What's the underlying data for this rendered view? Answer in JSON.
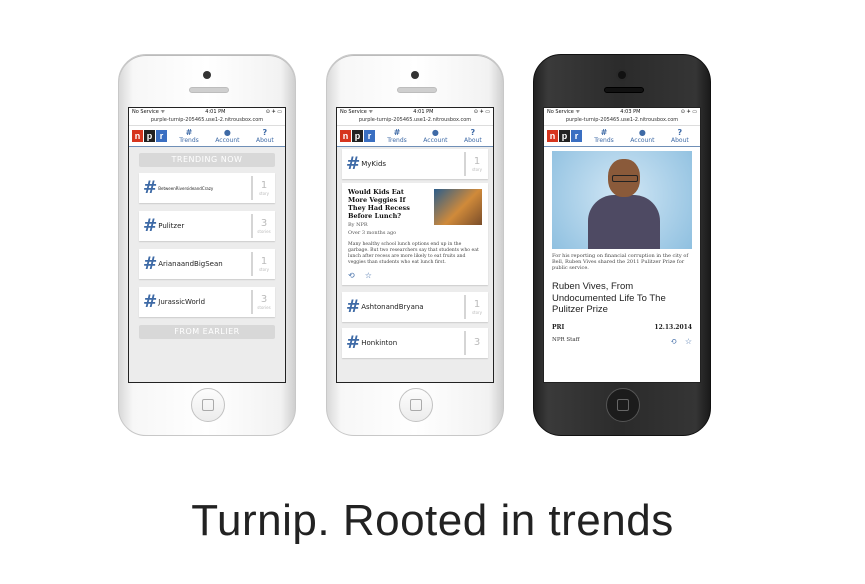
{
  "phones": [
    {
      "status_left": "No Service ᯤ",
      "time": "4:01 PM",
      "status_right": "⊙ ✈ ▭",
      "url": "purple-turnip-205465.use1-2.nitrousbox.com",
      "nav": [
        "Trends",
        "Account",
        "About"
      ],
      "banner_top": "TRENDING NOW",
      "tags": [
        {
          "name": "BetweenRiversideandCrazy",
          "count": "1",
          "unit": "story"
        },
        {
          "name": "Pulitzer",
          "count": "3",
          "unit": "stories"
        },
        {
          "name": "ArianaandBigSean",
          "count": "1",
          "unit": "story"
        },
        {
          "name": "JurassicWorld",
          "count": "3",
          "unit": "stories"
        }
      ],
      "banner_bottom": "FROM EARLIER"
    },
    {
      "status_left": "No Service ᯤ",
      "time": "4:01 PM",
      "status_right": "⊙ ✈ ▭",
      "url": "purple-turnip-205465.use1-2.nitrousbox.com",
      "nav": [
        "Trends",
        "Account",
        "About"
      ],
      "tag_top": {
        "name": "MyKids",
        "count": "1",
        "unit": "story"
      },
      "article": {
        "title": "Would Kids Eat More Veggies If They Had Recess Before Lunch?",
        "by": "By NPR",
        "when": "Over 3 months ago",
        "body": "Many healthy school lunch options end up in the garbage. But two researchers say that students who eat lunch after recess are more likely to eat fruits and veggies than students who eat lunch first."
      },
      "tag_mid": {
        "name": "AshtonandBryana",
        "count": "1",
        "unit": "story"
      },
      "tag_bottom": {
        "name": "Honkinton",
        "count": "3"
      }
    },
    {
      "status_left": "No Service ᯤ",
      "time": "4:03 PM",
      "status_right": "⊙ ✈ ▭",
      "url": "purple-turnip-205465.use1-2.nitrousbox.com",
      "nav": [
        "Trends",
        "Account",
        "About"
      ],
      "photo_caption": "For his reporting on financial corruption in the city of Bell, Ruben Vives shared the 2011 Pulitzer Prize for public service.",
      "headline": "Ruben Vives, From Undocumented Life To The Pulitzer Prize",
      "source": "PRI",
      "date": "12.13.2014",
      "author": "NPR Staff"
    }
  ],
  "logo": [
    "n",
    "p",
    "r"
  ],
  "hash_symbol": "#",
  "icons": {
    "retweet": "⟲",
    "favorite": "☆"
  },
  "tagline": "Turnip. Rooted in trends"
}
